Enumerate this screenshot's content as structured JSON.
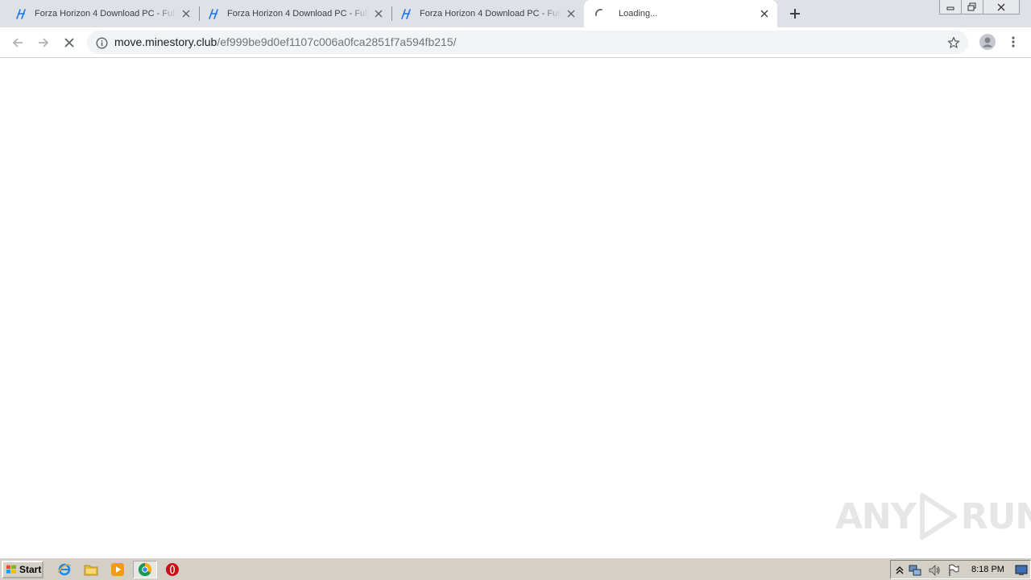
{
  "browser": {
    "tabs": [
      {
        "title": "Forza Horizon 4 Download PC - Full Game",
        "favicon": "site-logo-icon",
        "active": false
      },
      {
        "title": "Forza Horizon 4 Download PC - Full Game",
        "favicon": "site-logo-icon",
        "active": false
      },
      {
        "title": "Forza Horizon 4 Download PC - Full Game",
        "favicon": "site-logo-icon",
        "active": false
      },
      {
        "title": "Loading...",
        "favicon": "loading-spinner-icon",
        "active": true
      }
    ],
    "address": {
      "host": "move.minestory.club",
      "path": "/ef999be9d0ef1107c006a0fca2851f7a594fb215/"
    }
  },
  "watermark": {
    "left": "ANY",
    "right": "RUN"
  },
  "taskbar": {
    "start_label": "Start",
    "pinned": [
      "internet-explorer-icon",
      "explorer-folder-icon",
      "media-player-icon",
      "chrome-icon",
      "opera-icon"
    ],
    "clock": "8:18 PM"
  },
  "colors": {
    "tabstrip": "#dee1e6",
    "omnibox": "#f1f3f4",
    "taskbar": "#d4d0c8",
    "favicon_blue": "#1a73e8"
  }
}
